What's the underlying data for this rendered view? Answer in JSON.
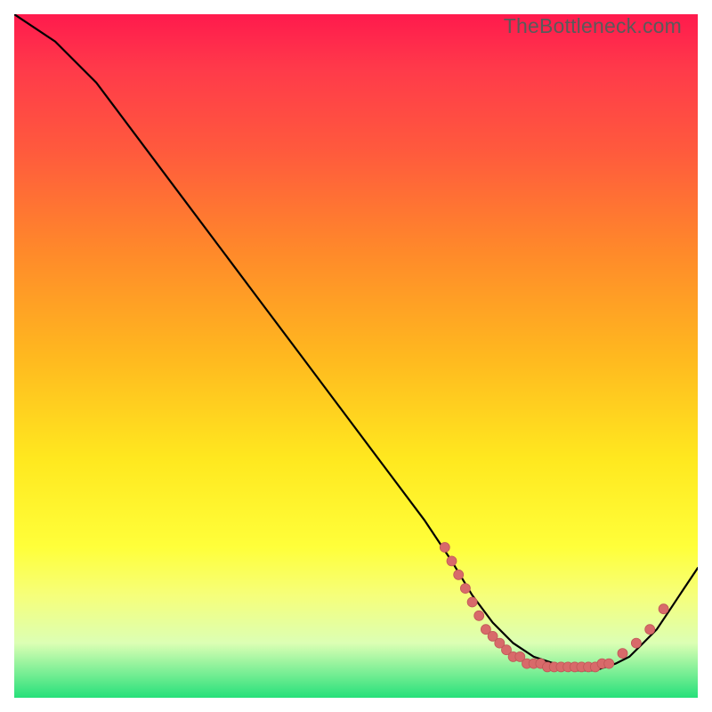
{
  "watermark": "TheBottleneck.com",
  "colors": {
    "line": "#000000",
    "dot_fill": "#d86a6a",
    "dot_stroke": "#c05858",
    "gradient_top": "#ff1a4d",
    "gradient_bottom": "#26e07a"
  },
  "chart_data": {
    "type": "line",
    "title": "",
    "xlabel": "",
    "ylabel": "",
    "xlim": [
      0,
      100
    ],
    "ylim": [
      0,
      100
    ],
    "series": [
      {
        "name": "curve",
        "x": [
          0,
          6,
          12,
          18,
          24,
          30,
          36,
          42,
          48,
          54,
          60,
          64,
          67,
          70,
          73,
          76,
          79,
          82,
          85,
          88,
          90,
          92,
          94,
          96,
          98,
          100
        ],
        "y": [
          100,
          96,
          90,
          82,
          74,
          66,
          58,
          50,
          42,
          34,
          26,
          20,
          15,
          11,
          8,
          6,
          5,
          4,
          4,
          5,
          6,
          8,
          10,
          13,
          16,
          19
        ]
      }
    ],
    "dots": [
      {
        "x": 63,
        "y": 22
      },
      {
        "x": 64,
        "y": 20
      },
      {
        "x": 65,
        "y": 18
      },
      {
        "x": 66,
        "y": 16
      },
      {
        "x": 67,
        "y": 14
      },
      {
        "x": 68,
        "y": 12
      },
      {
        "x": 69,
        "y": 10
      },
      {
        "x": 70,
        "y": 9
      },
      {
        "x": 71,
        "y": 8
      },
      {
        "x": 72,
        "y": 7
      },
      {
        "x": 73,
        "y": 6
      },
      {
        "x": 74,
        "y": 6
      },
      {
        "x": 75,
        "y": 5
      },
      {
        "x": 76,
        "y": 5
      },
      {
        "x": 77,
        "y": 5
      },
      {
        "x": 78,
        "y": 4.5
      },
      {
        "x": 79,
        "y": 4.5
      },
      {
        "x": 80,
        "y": 4.5
      },
      {
        "x": 81,
        "y": 4.5
      },
      {
        "x": 82,
        "y": 4.5
      },
      {
        "x": 83,
        "y": 4.5
      },
      {
        "x": 84,
        "y": 4.5
      },
      {
        "x": 85,
        "y": 4.5
      },
      {
        "x": 86,
        "y": 5
      },
      {
        "x": 87,
        "y": 5
      },
      {
        "x": 89,
        "y": 6.5
      },
      {
        "x": 91,
        "y": 8
      },
      {
        "x": 93,
        "y": 10
      },
      {
        "x": 95,
        "y": 13
      }
    ]
  }
}
